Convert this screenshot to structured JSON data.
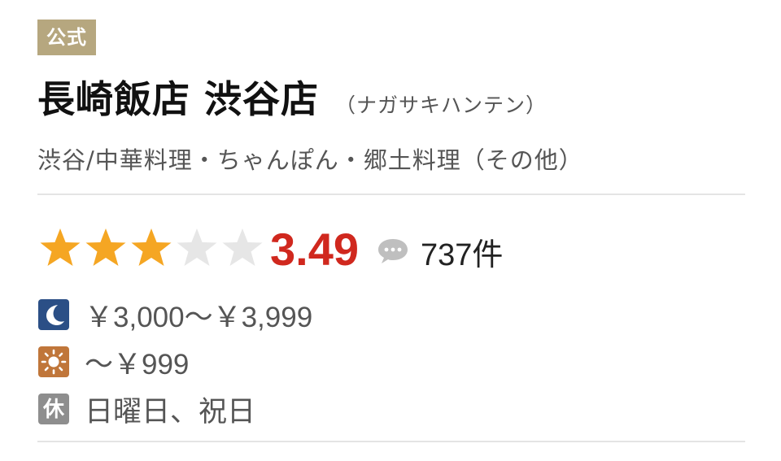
{
  "badge": {
    "label": "公式"
  },
  "restaurant": {
    "name": "長崎飯店 渋谷店",
    "reading": "（ナガサキハンテン）",
    "area_genre": "渋谷/中華料理・ちゃんぽん・郷土料理（その他）"
  },
  "rating": {
    "score": "3.49",
    "stars_filled": 3,
    "stars_total": 5,
    "review_count": "737件"
  },
  "colors": {
    "badge_bg": "#b6a77f",
    "star_filled": "#f5a623",
    "star_empty": "#e6e6e6",
    "score": "#d0281e",
    "dinner_icon": "#2b4f86",
    "lunch_icon": "#c0763a",
    "holiday_icon": "#8e8e8e"
  },
  "info": {
    "dinner_price": "￥3,000～￥3,999",
    "lunch_price": "～￥999",
    "holiday_icon_label": "休",
    "holidays": "日曜日、祝日"
  },
  "icons": {
    "dinner": "moon-icon",
    "lunch": "sun-icon",
    "holiday": "holiday-icon",
    "review": "speech-bubble-icon"
  }
}
